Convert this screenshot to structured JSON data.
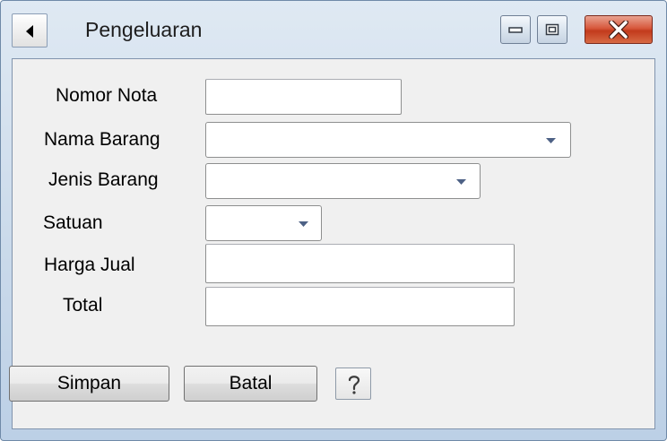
{
  "window": {
    "title": "Pengeluaran",
    "icons": {
      "back": "back-arrow-icon",
      "minimize": "minimize-icon",
      "maximize": "maximize-icon",
      "close": "close-icon",
      "help": "help-icon"
    },
    "colors": {
      "frame": "#c9d9ea",
      "client": "#f0f0f0",
      "close_button": "#c23a1c"
    }
  },
  "form": {
    "nomor_nota": {
      "label": "Nomor Nota",
      "value": ""
    },
    "nama_barang": {
      "label": "Nama Barang",
      "value": ""
    },
    "jenis_barang": {
      "label": "Jenis Barang",
      "value": ""
    },
    "satuan": {
      "label": "Satuan",
      "value": ""
    },
    "harga_jual": {
      "label": "Harga Jual",
      "value": ""
    },
    "total": {
      "label": "Total",
      "value": ""
    }
  },
  "buttons": {
    "simpan": "Simpan",
    "batal": "Batal"
  }
}
